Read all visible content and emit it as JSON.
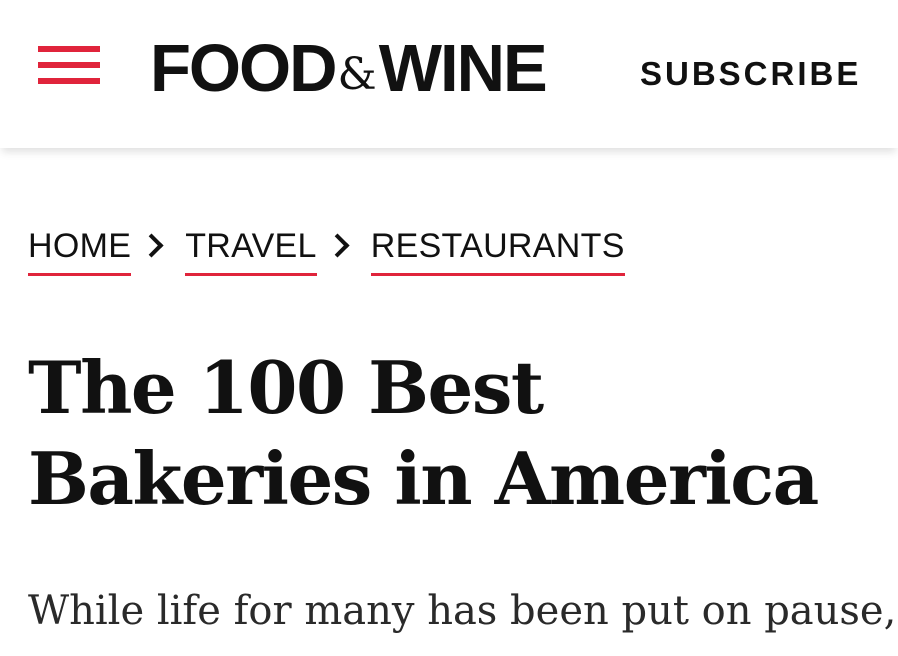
{
  "header": {
    "menu_icon": "hamburger-menu-icon",
    "logo": {
      "word1": "FOOD",
      "amp": "&",
      "word2": "WINE"
    },
    "subscribe_label": "SUBSCRIBE",
    "accent_color": "#e0243b"
  },
  "breadcrumb": {
    "items": [
      {
        "label": "HOME"
      },
      {
        "label": "TRAVEL"
      },
      {
        "label": "RESTAURANTS"
      }
    ],
    "separator_icon": "chevron-right-icon"
  },
  "article": {
    "title": "The 100 Best Bakeries in America",
    "intro_visible": "While life for many has been put on pause,"
  }
}
